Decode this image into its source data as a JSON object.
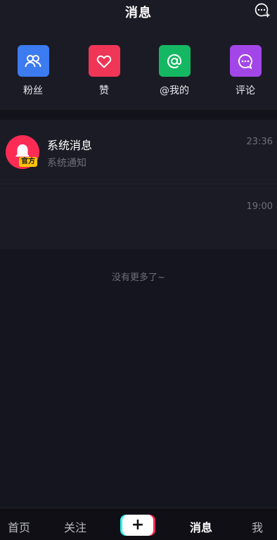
{
  "header": {
    "title": "消息"
  },
  "quick_actions": [
    {
      "label": "粉丝",
      "icon": "fans-icon",
      "color": "#3c7bf0"
    },
    {
      "label": "赞",
      "icon": "heart-icon",
      "color": "#f03657"
    },
    {
      "label": "@我的",
      "icon": "at-icon",
      "color": "#15b862"
    },
    {
      "label": "评论",
      "icon": "comment-icon",
      "color": "#a346e8"
    }
  ],
  "messages": [
    {
      "title": "系统消息",
      "subtitle": "系统通知",
      "time": "23:36",
      "badge": "官方",
      "avatar_icon": "bell-icon",
      "avatar_color": "#fe2c55"
    },
    {
      "title": "",
      "subtitle": "",
      "time": "19:00"
    }
  ],
  "footer_note": "没有更多了~",
  "nav": {
    "items": [
      "首页",
      "关注",
      "消息",
      "我"
    ],
    "active": "消息",
    "plus_symbol": "+"
  }
}
